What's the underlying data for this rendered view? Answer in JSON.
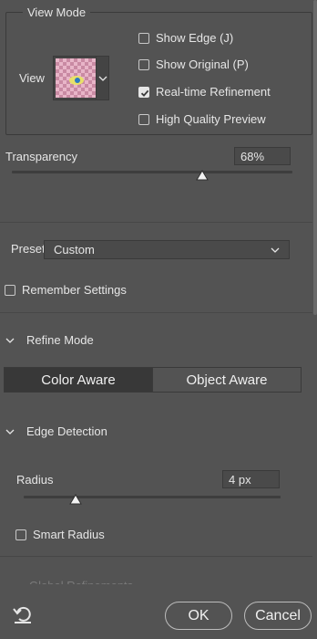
{
  "view_mode": {
    "title": "View Mode",
    "view_label": "View",
    "options": [
      {
        "label": "Show Edge (J)",
        "checked": false
      },
      {
        "label": "Show Original (P)",
        "checked": false
      },
      {
        "label": "Real-time Refinement",
        "checked": true
      },
      {
        "label": "High Quality Preview",
        "checked": false
      }
    ]
  },
  "transparency": {
    "label": "Transparency",
    "value_text": "68%",
    "value": 0.68
  },
  "preset": {
    "label": "Preset",
    "selected": "Custom",
    "remember_label": "Remember Settings",
    "remember_checked": false
  },
  "refine_mode": {
    "title": "Refine Mode",
    "options": [
      "Color Aware",
      "Object Aware"
    ],
    "active": "Color Aware"
  },
  "edge_detection": {
    "title": "Edge Detection",
    "radius_label": "Radius",
    "radius_value_text": "4 px",
    "radius_value": 0.2,
    "smart_radius_label": "Smart Radius",
    "smart_radius_checked": false
  },
  "footer": {
    "ok_label": "OK",
    "cancel_label": "Cancel",
    "partial_section": "Global Refinements"
  },
  "colors": {
    "panel_bg": "#535353",
    "text": "#e6e6e6",
    "field_bg": "#4a4a4a",
    "active_segment": "#383838"
  },
  "icons": {
    "reset": "reset-icon",
    "dropdown": "chevron-down-icon",
    "collapse": "chevron-down-icon",
    "checkmark": "checkmark-icon"
  }
}
